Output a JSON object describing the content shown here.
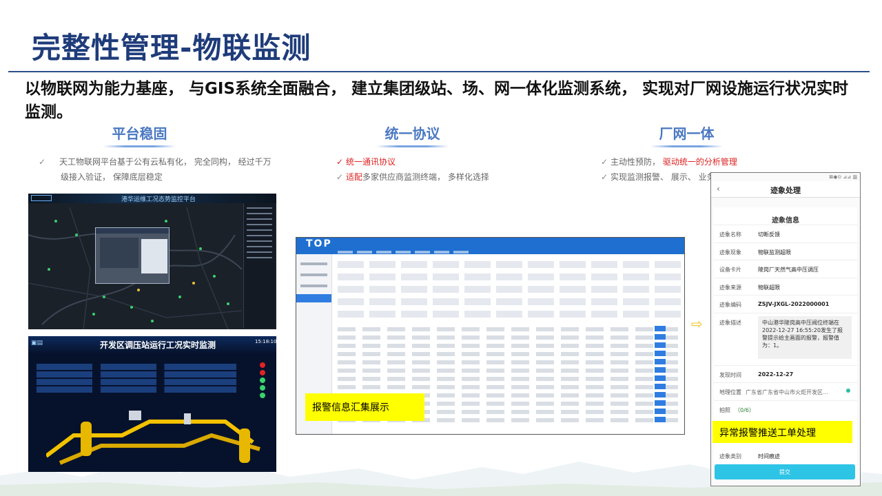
{
  "slide": {
    "title": "完整性管理-物联监测",
    "subtitle": "以物联网为能力基座， 与GIS系统全面融合， 建立集团级站、场、网一体化监测系统， 实现对厂网设施运行状况实时监测。"
  },
  "columns": [
    {
      "heading": "平台稳固",
      "bullets": [
        {
          "text": "天工物联网平台基于公有云私有化， 完全同构， 经过千万级接入验证， 保障底层稳定"
        }
      ]
    },
    {
      "heading": "统一协议",
      "bullets": [
        {
          "highlight": "统一通讯协议",
          "text": ""
        },
        {
          "highlight": "适配",
          "text": "多家供应商监测终端， 多样化选择"
        }
      ]
    },
    {
      "heading": "厂网一体",
      "bullets": [
        {
          "text": "主动性预防， ",
          "highlight": "驱动统一的分析管理"
        },
        {
          "text": "实现监测报警、 展示、 业务应用一体化"
        }
      ]
    }
  ],
  "screens": {
    "map_dashboard": {
      "title": "港华运维工况态势监控平台"
    },
    "station_monitor": {
      "title": "开发区调压站运行工况实时监测",
      "clock": "15:18:10"
    },
    "alarm_table": {
      "brand": "TOP",
      "callout": "报警信息汇集展示"
    },
    "mobile": {
      "status_bar": "⊠◉⊙ ⊿⊿ ▥",
      "back_icon": "‹",
      "header": "迹象处理",
      "section": "迹象信息",
      "fields": [
        {
          "key": "迹象名称",
          "value": "切断反馈"
        },
        {
          "key": "迹象现象",
          "value": "物联监测超限"
        },
        {
          "key": "设备卡片",
          "value": "陵岗厂天然气高中压调压"
        },
        {
          "key": "迹象来源",
          "value": "物联超限"
        },
        {
          "key": "迹象编码",
          "value": "ZSJV-JXGL-2022000001"
        }
      ],
      "desc_key": "迹象描述",
      "desc_value": "中山港华陵岗高中压阀位终端在2022-12-27 16:55:20发生了报警提示给主画面的报警，报警值为：1。",
      "found_key": "发现时间",
      "found_value": "2022-12-27",
      "loc_key": "地理位置",
      "loc_value": "广东省广东省中山市火炬开发区...",
      "photo_key": "拍照",
      "photo_value": "（0/6）",
      "type_key": "迹象类别",
      "type_value": "时间痕迹",
      "submit": "提交",
      "callout": "异常报警推送工单处理"
    }
  },
  "arrow": "⇨",
  "colors": {
    "title": "#1f3c7a",
    "heading": "#4a78c2",
    "highlight_red": "#d22222",
    "callout": "#ffff00",
    "brand_blue": "#1f6fd0"
  }
}
